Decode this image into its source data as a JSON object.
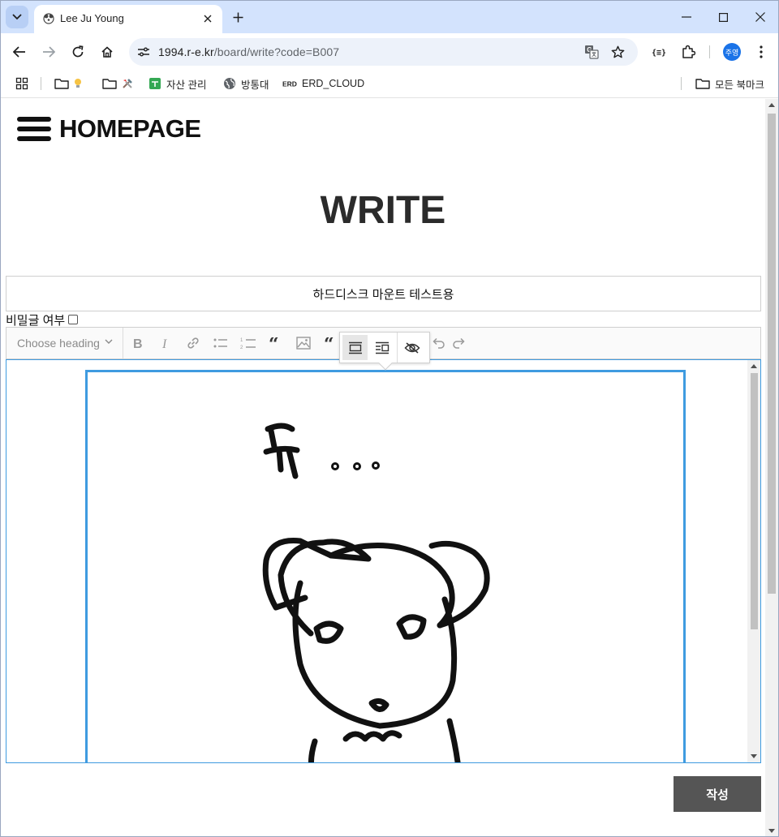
{
  "browser": {
    "tab_title": "Lee Ju Young",
    "url_host": "1994.r-e.kr",
    "url_path": "/board/write?code=B007",
    "profile_label": "주영"
  },
  "bookmarks": {
    "items": [
      {
        "label": "",
        "icon": "folder-icon"
      },
      {
        "label": "",
        "icon": "folder-icon"
      },
      {
        "label": "자산 관리",
        "icon": "sheets-icon"
      },
      {
        "label": "방통대",
        "icon": "globe-icon"
      },
      {
        "label": "ERD_CLOUD",
        "icon": "erd-icon"
      }
    ],
    "all_bookmarks": "모든 북마크"
  },
  "site": {
    "logo": "HOMEPAGE",
    "page_title": "WRITE"
  },
  "form": {
    "title_value": "하드디스크 마운트 테스트용",
    "secret_label": "비밀글 여부",
    "secret_checked": false,
    "heading_placeholder": "Choose heading",
    "submit_label": "작성"
  },
  "editor": {
    "toolbar_items": [
      "bold-icon",
      "italic-icon",
      "link-icon",
      "bulleted-list-icon",
      "numbered-list-icon",
      "block-quote-icon",
      "image-icon",
      "quote-icon",
      "undo-icon",
      "redo-icon"
    ],
    "image_toolbar": [
      "full-size-image-icon",
      "side-image-icon",
      "alt-text-icon"
    ],
    "image_text": "듀 ..."
  },
  "colors": {
    "accent": "#3f9be0",
    "button": "#555555",
    "tabstrip": "#d3e3fd"
  }
}
